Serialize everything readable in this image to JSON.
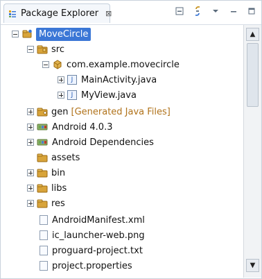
{
  "panel": {
    "title": "Package Explorer",
    "close_glyph": "⊠"
  },
  "tree": {
    "project": "MoveCircle",
    "src": "src",
    "package": "com.example.movecircle",
    "files": [
      "MainActivity.java",
      "MyView.java"
    ],
    "gen": "gen",
    "gen_decor": "[Generated Java Files]",
    "android_403": "Android 4.0.3",
    "android_deps": "Android Dependencies",
    "assets": "assets",
    "bin": "bin",
    "libs": "libs",
    "res": "res",
    "manifest": "AndroidManifest.xml",
    "icon_png": "ic_launcher-web.png",
    "proguard": "proguard-project.txt",
    "properties": "project.properties"
  }
}
